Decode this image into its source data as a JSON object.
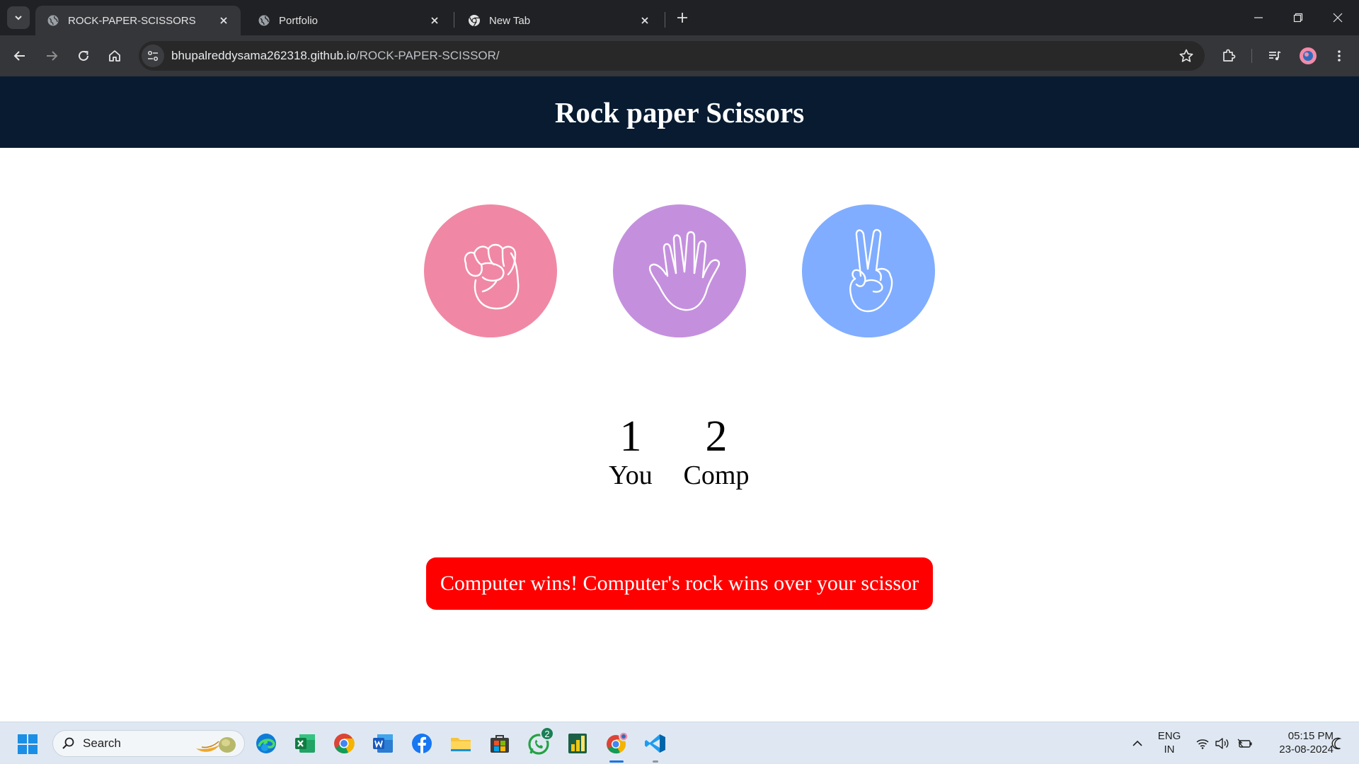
{
  "browser": {
    "tabs": [
      {
        "title": "ROCK-PAPER-SCISSORS",
        "active": true
      },
      {
        "title": "Portfolio",
        "active": false
      },
      {
        "title": "New Tab",
        "active": false
      }
    ],
    "url_host": "bhupalreddysama262318.github.io",
    "url_path": "/ROCK-PAPER-SCISSOR/"
  },
  "page": {
    "title": "Rock paper Scissors",
    "choices": [
      {
        "id": "rock",
        "icon": "fist-icon",
        "color": "#f088a5"
      },
      {
        "id": "paper",
        "icon": "open-hand-icon",
        "color": "#c490de"
      },
      {
        "id": "scissors",
        "icon": "peace-hand-icon",
        "color": "#80adff"
      }
    ],
    "score": {
      "user": "1",
      "user_label": "You",
      "comp": "2",
      "comp_label": "Comp"
    },
    "message": "Computer wins! Computer's rock wins over your scissor",
    "message_color": "#ff0000",
    "header_color": "#081b31"
  },
  "taskbar": {
    "search_placeholder": "Search",
    "whatsapp_badge": "2",
    "lang_line1": "ENG",
    "lang_line2": "IN",
    "time": "05:15 PM",
    "date": "23-08-2024"
  }
}
